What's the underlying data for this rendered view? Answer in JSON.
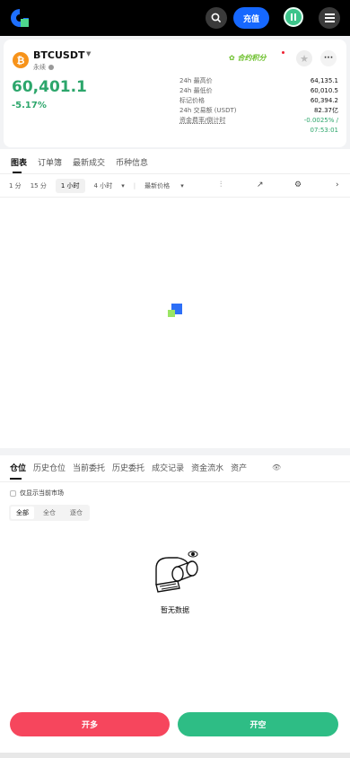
{
  "header": {
    "deposit_label": "充值",
    "icons": [
      "logo",
      "search-icon",
      "pause-avatar-icon",
      "menu-icon"
    ]
  },
  "ticker": {
    "symbol": "BTCUSDT",
    "type": "永续",
    "last_price": "60,401.1",
    "change": "-5.17%",
    "points_label": "合约积分",
    "stats": [
      {
        "label": "24h 最高价",
        "value": "64,135.1"
      },
      {
        "label": "24h 最低价",
        "value": "60,010.5"
      },
      {
        "label": "标记价格",
        "value": "60,394.2"
      },
      {
        "label": "24h 交易额 (USDT)",
        "value": "82.37亿"
      }
    ],
    "funding_label": "资金费率/倒计时",
    "funding_rate": "-0.0025% /",
    "funding_countdown": "07:53:01",
    "colors": {
      "up": "#2ca66b",
      "accent": "#1668ff"
    }
  },
  "chart_tabs": [
    "图表",
    "订单簿",
    "最新成交",
    "币种信息"
  ],
  "intervals": [
    "1 分",
    "15 分",
    "1 小时",
    "4 小时"
  ],
  "interval_more": "▾",
  "price_type": "最新价格",
  "bottom_tabs": [
    "仓位",
    "历史仓位",
    "当前委托",
    "历史委托",
    "成交记录",
    "资金流水",
    "资产"
  ],
  "only_current_market": "仅显示当前市场",
  "margin_modes": [
    "全部",
    "全仓",
    "逐仓"
  ],
  "empty_text": "暂无数据",
  "actions": {
    "long": "开多",
    "short": "开空"
  }
}
